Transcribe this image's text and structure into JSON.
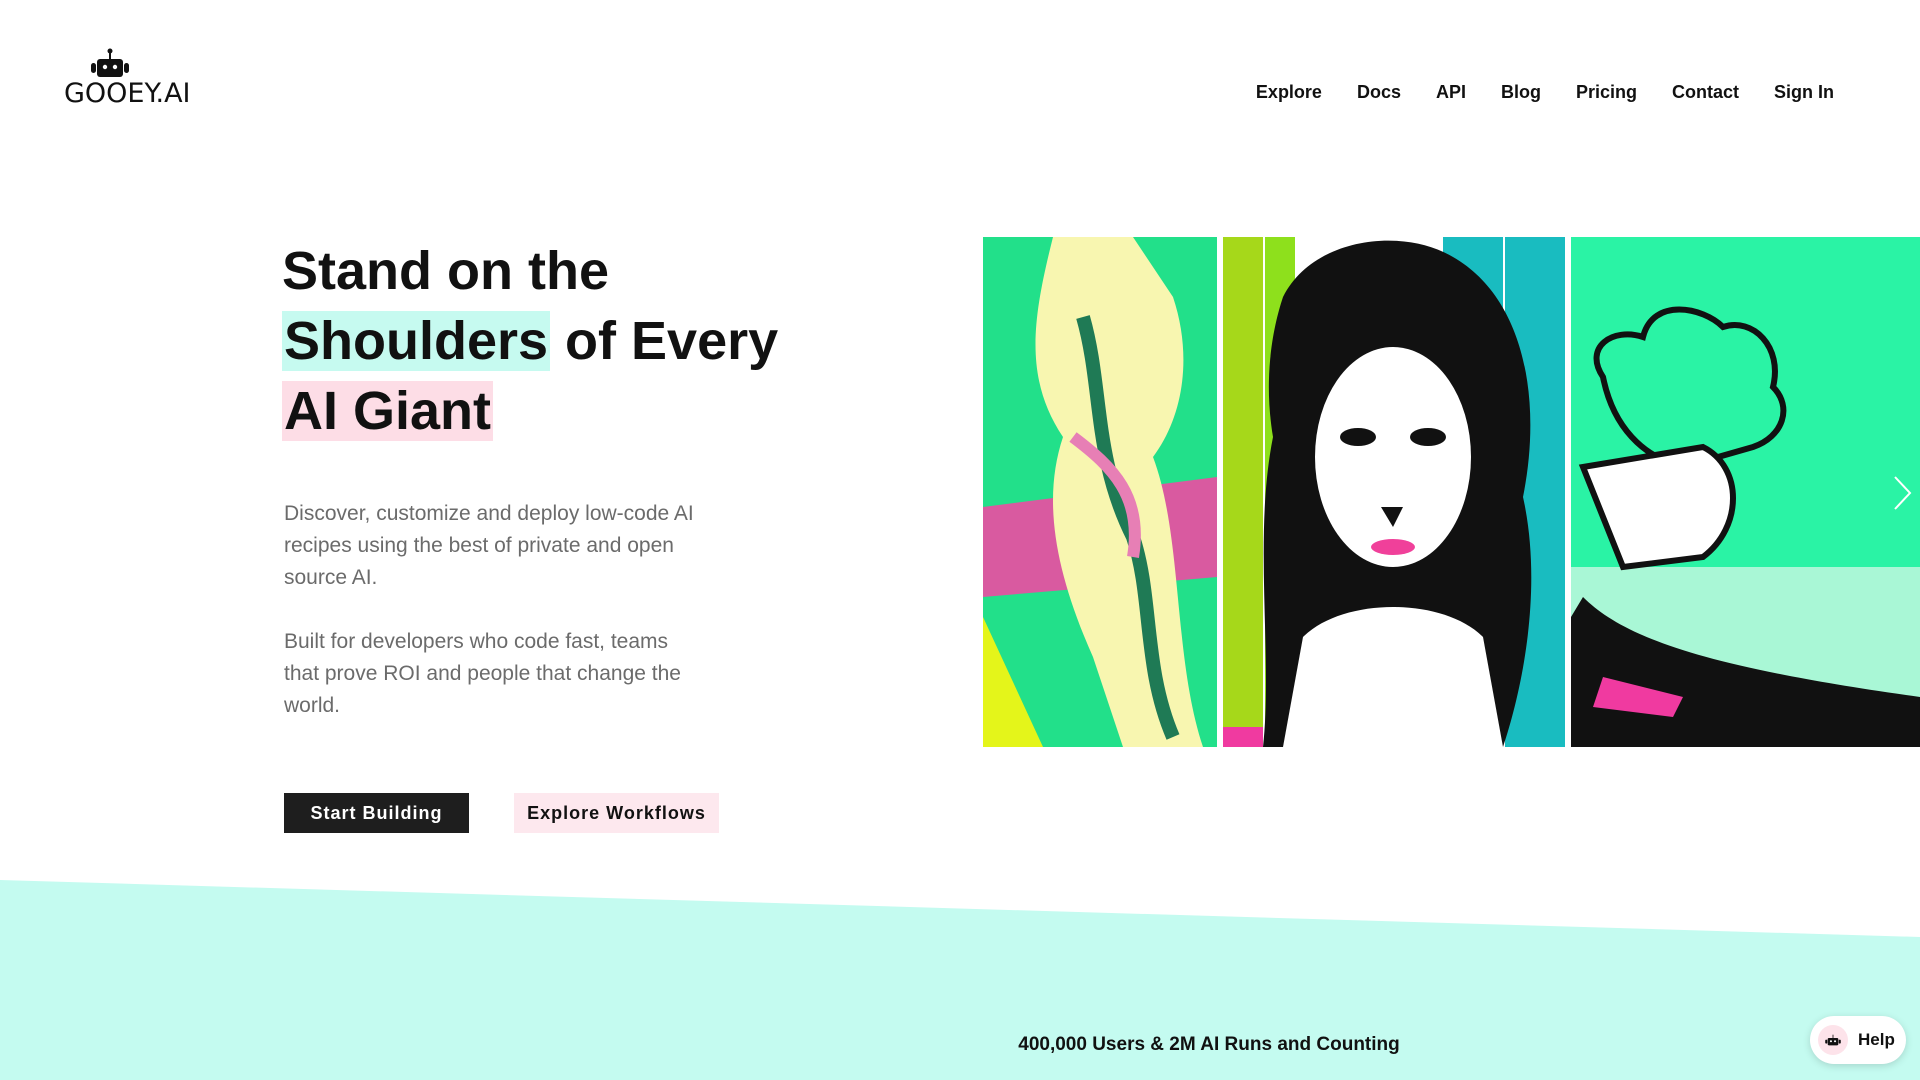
{
  "header": {
    "logo_text": "GOOEY.AI",
    "nav": [
      "Explore",
      "Docs",
      "API",
      "Blog",
      "Pricing",
      "Contact",
      "Sign In"
    ]
  },
  "hero": {
    "title": {
      "line1": "Stand on the",
      "line2_highlight": "Shoulders",
      "line2_rest": " of Every",
      "line3_highlight": "AI Giant"
    },
    "paragraphs": [
      "Discover, customize and deploy low-code AI recipes using the best of private and open source AI.",
      "Built for developers who code fast, teams that prove ROI and people that change the world."
    ],
    "primary_button": "Start Building",
    "secondary_button": "Explore Workflows"
  },
  "stats": "400,000 Users & 2M AI Runs and Counting",
  "help": {
    "label": "Help",
    "icon": "robot-icon"
  },
  "colors": {
    "cyan": "#c6faf0",
    "pink": "#fddde6",
    "dark": "#1e1e1e"
  }
}
